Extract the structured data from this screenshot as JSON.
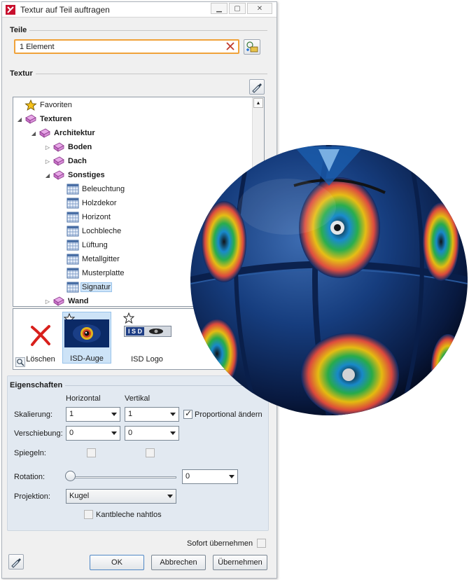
{
  "window": {
    "title": "Textur auf Teil auftragen"
  },
  "teile": {
    "heading": "Teile",
    "input_value": "1 Element"
  },
  "textur": {
    "heading": "Textur",
    "tree": [
      {
        "label": "Favoriten",
        "icon": "star-icon",
        "bold": false
      },
      {
        "label": "Texturen",
        "icon": "book-icon",
        "bold": true
      },
      {
        "label": "Architektur",
        "icon": "book-icon",
        "bold": true
      },
      {
        "label": "Boden",
        "icon": "book-icon",
        "bold": true
      },
      {
        "label": "Dach",
        "icon": "book-icon",
        "bold": true
      },
      {
        "label": "Sonstiges",
        "icon": "book-icon",
        "bold": true
      },
      {
        "label": "Beleuchtung",
        "icon": "texture-icon",
        "bold": false
      },
      {
        "label": "Holzdekor",
        "icon": "texture-icon",
        "bold": false
      },
      {
        "label": "Horizont",
        "icon": "texture-icon",
        "bold": false
      },
      {
        "label": "Lochbleche",
        "icon": "texture-icon",
        "bold": false
      },
      {
        "label": "Lüftung",
        "icon": "texture-icon",
        "bold": false
      },
      {
        "label": "Metallgitter",
        "icon": "texture-icon",
        "bold": false
      },
      {
        "label": "Musterplatte",
        "icon": "texture-icon",
        "bold": false
      },
      {
        "label": "Signatur",
        "icon": "texture-icon",
        "bold": false
      },
      {
        "label": "Wand",
        "icon": "book-icon",
        "bold": true
      }
    ],
    "gallery": [
      {
        "label": "Löschen"
      },
      {
        "label": "ISD-Auge"
      },
      {
        "label": "ISD Logo",
        "logo_text": "I S D"
      }
    ]
  },
  "eigenschaften": {
    "heading": "Eigenschaften",
    "col_horizontal": "Horizontal",
    "col_vertikal": "Vertikal",
    "skalierung_label": "Skalierung:",
    "skalierung_h": "1",
    "skalierung_v": "1",
    "proportional_label": "Proportional ändern",
    "verschiebung_label": "Verschiebung:",
    "verschiebung_h": "0",
    "verschiebung_v": "0",
    "spiegeln_label": "Spiegeln:",
    "rotation_label": "Rotation:",
    "rotation_value": "0",
    "projektion_label": "Projektion:",
    "projektion_value": "Kugel",
    "kantbleche_label": "Kantbleche nahtlos"
  },
  "footer": {
    "sofort_label": "Sofort übernehmen",
    "ok": "OK",
    "abbrechen": "Abbrechen",
    "uebernehmen": "Übernehmen"
  },
  "colors": {
    "accent_focus": "#f0a23a",
    "selection": "#cde3f7",
    "sphere_base": "#0d2a5c"
  }
}
